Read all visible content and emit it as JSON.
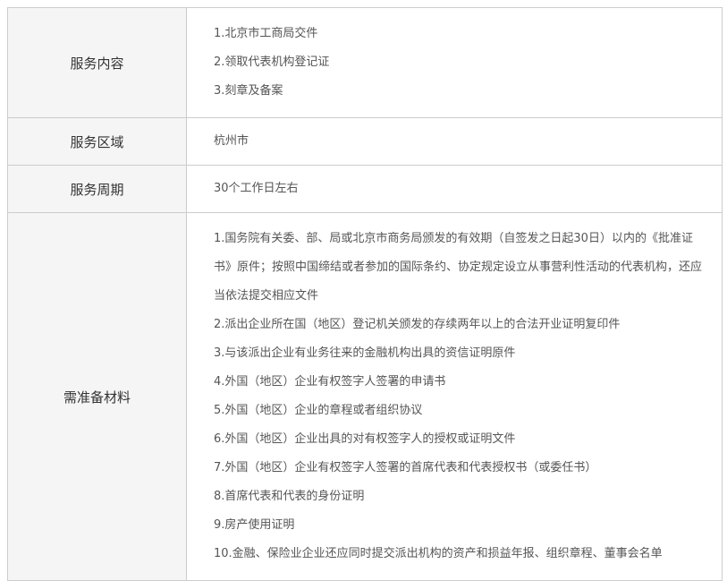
{
  "rows": {
    "content": {
      "label": "服务内容",
      "items": [
        "1.北京市工商局交件",
        "2.领取代表机构登记证",
        "3.刻章及备案"
      ]
    },
    "region": {
      "label": "服务区域",
      "value": "杭州市"
    },
    "period": {
      "label": "服务周期",
      "value": "30个工作日左右"
    },
    "materials": {
      "label": "需准备材料",
      "items": [
        "1.国务院有关委、部、局或北京市商务局颁发的有效期（自签发之日起30日）以内的《批准证书》原件；按照中国缔结或者参加的国际条约、协定规定设立从事营利性活动的代表机构，还应当依法提交相应文件",
        "2.派出企业所在国（地区）登记机关颁发的存续两年以上的合法开业证明复印件",
        "3.与该派出企业有业务往来的金融机构出具的资信证明原件",
        "4.外国（地区）企业有权签字人签署的申请书",
        "5.外国（地区）企业的章程或者组织协议",
        "6.外国（地区）企业出具的对有权签字人的授权或证明文件",
        "7.外国（地区）企业有权签字人签署的首席代表和代表授权书（或委任书）",
        "8.首席代表和代表的身份证明",
        "9.房产使用证明",
        "10.金融、保险业企业还应同时提交派出机构的资产和损益年报、组织章程、董事会名单"
      ]
    }
  }
}
